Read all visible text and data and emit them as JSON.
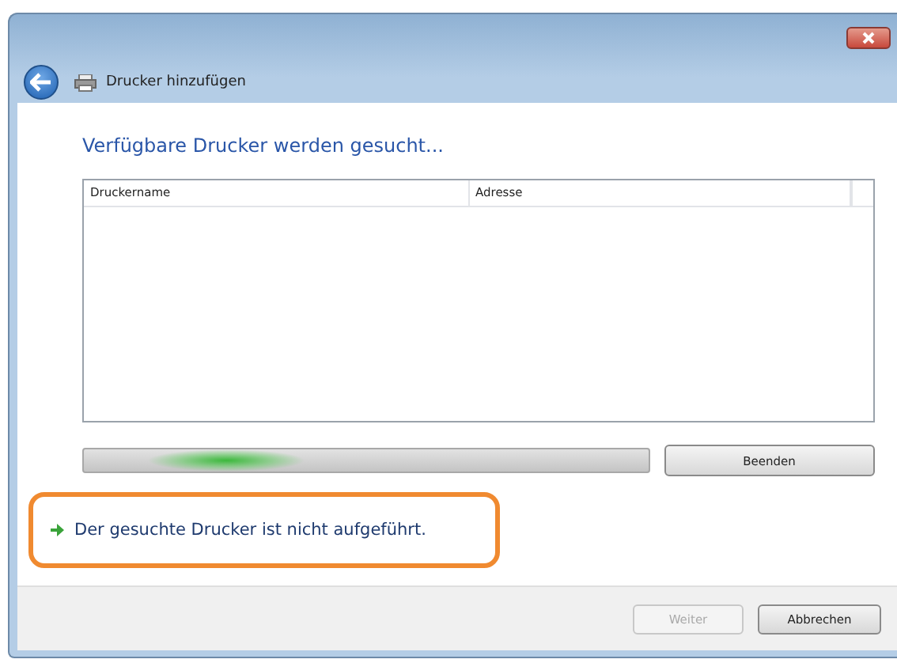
{
  "window": {
    "title": "Drucker hinzufügen"
  },
  "heading": "Verfügbare Drucker werden gesucht...",
  "table": {
    "columns": [
      "Druckername",
      "Adresse"
    ]
  },
  "search_progress": {
    "on": true
  },
  "stop_button": "Beenden",
  "link": {
    "text": "Der gesuchte Drucker ist nicht aufgeführt.",
    "highlighted": true
  },
  "buttons": [
    {
      "label": "Weiter",
      "disabled": true
    },
    {
      "label": "Abbrechen",
      "disabled": false
    }
  ]
}
